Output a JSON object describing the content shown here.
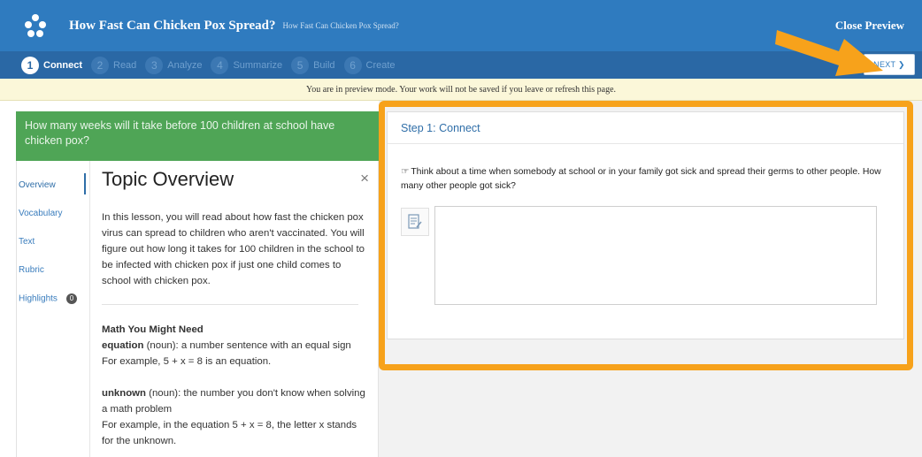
{
  "app": {
    "title": "How Fast Can Chicken Pox Spread?",
    "subtitle": "How Fast Can Chicken Pox Spread?",
    "close_label": "Close Preview"
  },
  "steps": [
    {
      "num": "1",
      "label": "Connect",
      "active": true
    },
    {
      "num": "2",
      "label": "Read",
      "active": false
    },
    {
      "num": "3",
      "label": "Analyze",
      "active": false
    },
    {
      "num": "4",
      "label": "Summarize",
      "active": false
    },
    {
      "num": "5",
      "label": "Build",
      "active": false
    },
    {
      "num": "6",
      "label": "Create",
      "active": false
    }
  ],
  "next_label": "NEXT ❯",
  "notice": "You are in preview mode. Your work will not be saved if you leave or refresh this page.",
  "question": "How many weeks will it take before 100 children at school have chicken pox?",
  "sidenav": {
    "items": [
      "Overview",
      "Vocabulary",
      "Text",
      "Rubric",
      "Highlights"
    ],
    "highlights_count": "0"
  },
  "overview": {
    "title": "Topic Overview",
    "close": "×",
    "intro": "In this lesson, you will read about how fast the chicken pox virus can spread to children who aren't vaccinated. You will figure out how long it takes for 100 children in the school to be infected with chicken pox if just one child comes to school with chicken pox.",
    "math_heading": "Math You Might Need",
    "term1": "equation",
    "term1_def": " (noun): a number sentence with an equal sign",
    "term1_example": "For example, 5 + x = 8 is an equation.",
    "term2": "unknown",
    "term2_def": " (noun): the number you don't know when solving a math problem",
    "term2_example": "For example, in the equation 5 + x = 8, the letter x stands for the unknown."
  },
  "step_card": {
    "header": "Step 1: Connect",
    "prompt": "Think about a time when somebody at school or in your family got sick and spread their germs to other people. How many other people got sick?",
    "answer_value": ""
  },
  "colors": {
    "titlebar": "#2f7bbf",
    "stepbar": "#2a68a5",
    "question_banner": "#4fa556",
    "highlight": "#f7a21b"
  }
}
